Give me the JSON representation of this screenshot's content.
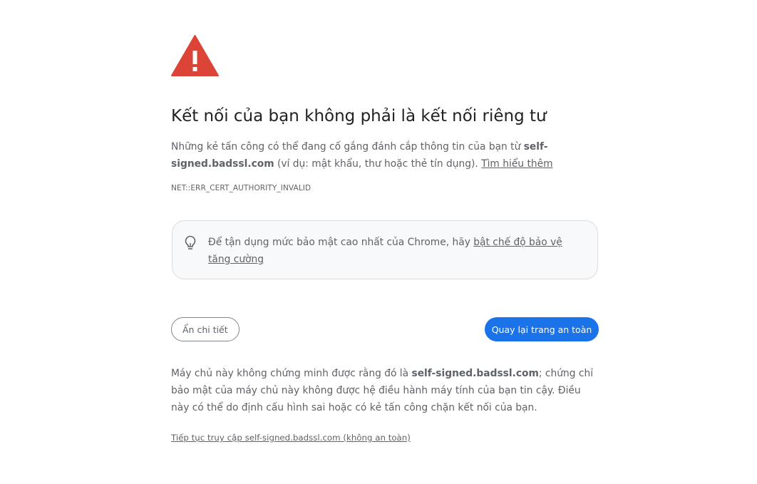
{
  "heading": "Kết nối của bạn không phải là kết nối riêng tư",
  "explanation": {
    "prefix": "Những kẻ tấn công có thể đang cố gắng đánh cắp thông tin của bạn từ ",
    "domain": "self-signed.badssl.com",
    "suffix": " (ví dụ: mật khẩu, thư hoặc thẻ tín dụng). ",
    "learn_more": "Tìm hiểu thêm"
  },
  "error_code": "NET::ERR_CERT_AUTHORITY_INVALID",
  "promo": {
    "text": "Để tận dụng mức bảo mật cao nhất của Chrome, hãy ",
    "link": "bật chế độ bảo vệ tăng cường"
  },
  "buttons": {
    "hide_details": "Ẩn chi tiết",
    "back_to_safety": "Quay lại trang an toàn"
  },
  "details": {
    "prefix": "Máy chủ này không chứng minh được rằng đó là ",
    "domain": "self-signed.badssl.com",
    "suffix": "; chứng chỉ bảo mật của máy chủ này không được hệ điều hành máy tính của bạn tin cậy. Điều này có thể do định cấu hình sai hoặc có kẻ tấn công chặn kết nối của bạn."
  },
  "proceed_link": "Tiếp tục truy cập self-signed.badssl.com (không an toàn)",
  "colors": {
    "warning_red": "#db4437",
    "primary_blue": "#1a73e8",
    "text": "#5f6368",
    "heading": "#202124"
  },
  "icons": {
    "warning": "warning-triangle-icon",
    "bulb": "lightbulb-icon"
  }
}
